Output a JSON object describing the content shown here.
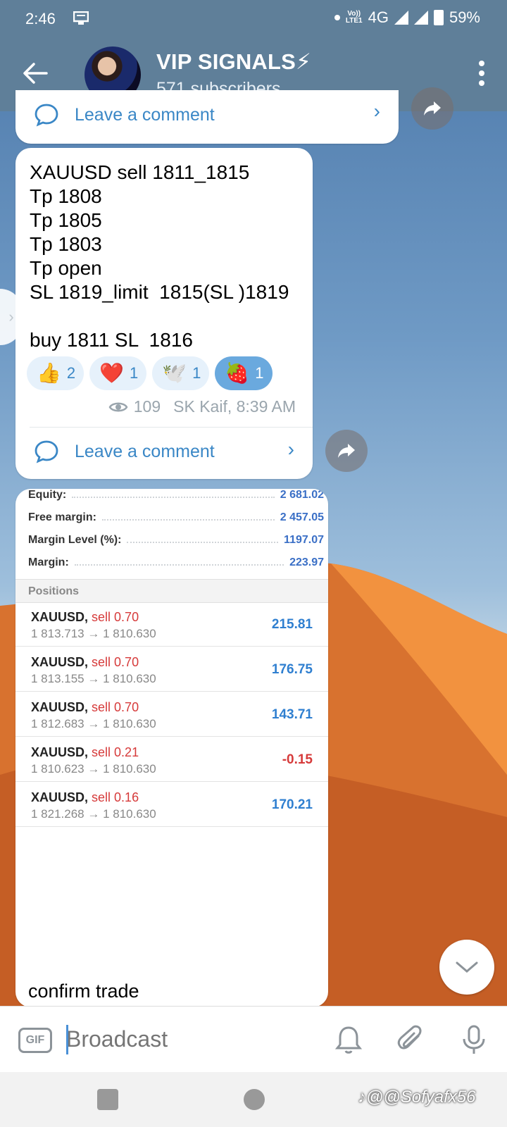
{
  "status_bar": {
    "time": "2:46",
    "network_top": "Vo))",
    "network_bottom": "LTE1",
    "network_type": "4G",
    "battery": "59%"
  },
  "header": {
    "title": "VIP SIGNALS⚡",
    "subtitle": "571 subscribers"
  },
  "messages": {
    "prev_comment_label": "Leave a comment",
    "signal_text": "XAUUSD sell 1811_1815\nTp 1808\nTp 1805\nTp 1803\nTp open\nSL 1819_limit  1815(SL )1819\n\nbuy 1811 SL  1816",
    "reactions": [
      {
        "emoji": "👍",
        "count": "2",
        "selected": false
      },
      {
        "emoji": "❤️",
        "count": "1",
        "selected": false
      },
      {
        "emoji": "🕊️",
        "count": "1",
        "selected": false
      },
      {
        "emoji": "🍓",
        "count": "1",
        "selected": true
      }
    ],
    "views": "109",
    "author_time": "SK Kaif, 8:39 AM",
    "comment_label": "Leave a comment",
    "image_caption": "confirm trade"
  },
  "account": {
    "equity_label": "Equity:",
    "equity_value": "2 681.02",
    "free_margin_label": "Free margin:",
    "free_margin_value": "2 457.05",
    "margin_level_label": "Margin Level (%):",
    "margin_level_value": "1197.07",
    "margin_label": "Margin:",
    "margin_value": "223.97",
    "positions_header": "Positions"
  },
  "positions": [
    {
      "symbol": "XAUUSD,",
      "side": "sell 0.70",
      "prices": "1 813.713 → 1 810.630",
      "pl": "215.81",
      "negative": false
    },
    {
      "symbol": "XAUUSD,",
      "side": "sell 0.70",
      "prices": "1 813.155 → 1 810.630",
      "pl": "176.75",
      "negative": false
    },
    {
      "symbol": "XAUUSD,",
      "side": "sell 0.70",
      "prices": "1 812.683 → 1 810.630",
      "pl": "143.71",
      "negative": false
    },
    {
      "symbol": "XAUUSD,",
      "side": "sell 0.21",
      "prices": "1 810.623 → 1 810.630",
      "pl": "-0.15",
      "negative": true
    },
    {
      "symbol": "XAUUSD,",
      "side": "sell 0.16",
      "prices": "1 821.268 → 1 810.630",
      "pl": "170.21",
      "negative": false
    }
  ],
  "input_bar": {
    "gif_label": "GIF",
    "placeholder": "Broadcast"
  },
  "nav": {
    "watermark": "♪@@Sofyafx56"
  },
  "colors": {
    "header_bg": "#5f7f99",
    "accent": "#3a87c6",
    "profit": "#2f7fd0",
    "loss": "#d63a3a"
  }
}
